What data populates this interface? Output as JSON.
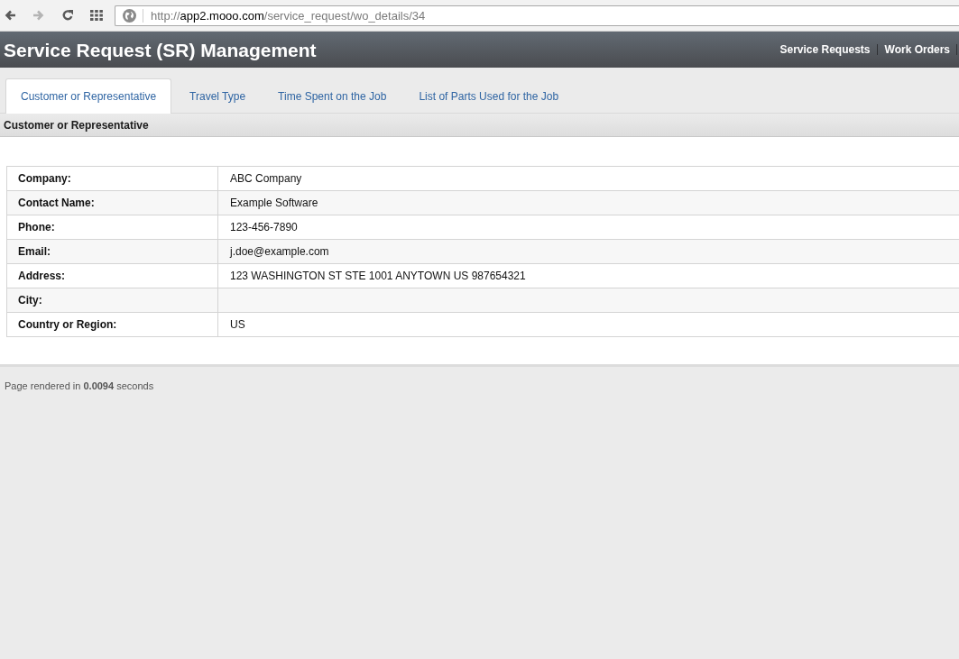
{
  "browser": {
    "buttons": [
      {
        "kind": "back",
        "disabled": false
      },
      {
        "kind": "forward",
        "disabled": true
      },
      {
        "kind": "reload",
        "disabled": false
      },
      {
        "kind": "apps",
        "disabled": false
      }
    ],
    "url": {
      "scheme": "http://",
      "host": "app2.mooo.com",
      "path": "/service_request/wo_details/34"
    }
  },
  "header": {
    "title": "Service Request (SR) Management",
    "nav": [
      {
        "label": "Service Requests"
      },
      {
        "label": "Work Orders"
      }
    ]
  },
  "tabs": [
    {
      "label": "Customer or Representative",
      "selected": true
    },
    {
      "label": "Travel Type",
      "selected": false
    },
    {
      "label": "Time Spent on the Job",
      "selected": false
    },
    {
      "label": "List of Parts Used for the Job",
      "selected": false
    }
  ],
  "section": {
    "title": "Customer or Representative"
  },
  "details": {
    "rows": [
      {
        "label": "Company:",
        "value": "ABC Company"
      },
      {
        "label": "Contact Name:",
        "value": "Example Software"
      },
      {
        "label": "Phone:",
        "value": "123-456-7890"
      },
      {
        "label": "Email:",
        "value": "j.doe@example.com"
      },
      {
        "label": "Address:",
        "value": "123 WASHINGTON ST STE 1001 ANYTOWN US 987654321"
      },
      {
        "label": "City:"
      },
      {
        "label": "Country or Region:",
        "value": "US"
      }
    ]
  },
  "footer": {
    "text": "Page rendered in **0.0094** seconds"
  }
}
